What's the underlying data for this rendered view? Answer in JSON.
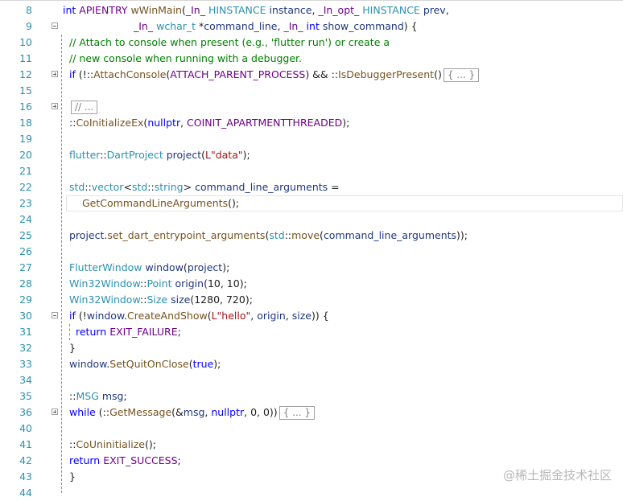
{
  "lines": [
    {
      "n": "8",
      "fold": "",
      "parts": [
        [
          "kw",
          "int "
        ],
        [
          "mac",
          "APIENTRY "
        ],
        [
          "fn",
          "wWinMain"
        ],
        [
          "pl",
          "("
        ],
        [
          "mac",
          "_In_ "
        ],
        [
          "ty",
          "HINSTANCE"
        ],
        [
          "id",
          " instance"
        ],
        [
          "pl",
          ", "
        ],
        [
          "mac",
          "_In_opt_ "
        ],
        [
          "ty",
          "HINSTANCE"
        ],
        [
          "id",
          " prev"
        ],
        [
          "pl",
          ","
        ]
      ]
    },
    {
      "n": "9",
      "fold": "minus",
      "parts": [
        [
          "mac",
          "_In_ "
        ],
        [
          "ty",
          "wchar_t"
        ],
        [
          "pl",
          " *"
        ],
        [
          "id",
          "command_line"
        ],
        [
          "pl",
          ", "
        ],
        [
          "mac",
          "_In_ "
        ],
        [
          "kw",
          "int "
        ],
        [
          "id",
          "show_command"
        ],
        [
          "pl",
          ") {"
        ]
      ]
    },
    {
      "n": "10",
      "fold": "",
      "parts": [
        [
          "cm",
          "// Attach to console when present (e.g., 'flutter run') or create a"
        ]
      ]
    },
    {
      "n": "11",
      "fold": "",
      "parts": [
        [
          "cm",
          "// new console when running with a debugger."
        ]
      ]
    },
    {
      "n": "12",
      "fold": "plus",
      "parts": [
        [
          "kw",
          "if "
        ],
        [
          "pl",
          "(!::"
        ],
        [
          "fn",
          "AttachConsole"
        ],
        [
          "pl",
          "("
        ],
        [
          "mac",
          "ATTACH_PARENT_PROCESS"
        ],
        [
          "pl",
          ") && ::"
        ],
        [
          "fn",
          "IsDebuggerPresent"
        ],
        [
          "pl",
          "()"
        ]
      ],
      "collapsed": "{ ... }"
    },
    {
      "n": "15",
      "fold": "",
      "parts": []
    },
    {
      "n": "16",
      "fold": "plus",
      "parts": [],
      "collapsed": "// ..."
    },
    {
      "n": "18",
      "fold": "",
      "parts": [
        [
          "pl",
          "::"
        ],
        [
          "fn",
          "CoInitializeEx"
        ],
        [
          "pl",
          "("
        ],
        [
          "kw",
          "nullptr"
        ],
        [
          "pl",
          ", "
        ],
        [
          "mac",
          "COINIT_APARTMENTTHREADED"
        ],
        [
          "pl",
          ");"
        ]
      ]
    },
    {
      "n": "19",
      "fold": "",
      "parts": []
    },
    {
      "n": "20",
      "fold": "",
      "parts": [
        [
          "ty",
          "flutter"
        ],
        [
          "pl",
          "::"
        ],
        [
          "ty",
          "DartProject"
        ],
        [
          "id",
          " project"
        ],
        [
          "pl",
          "("
        ],
        [
          "str",
          "L\"data\""
        ],
        [
          "pl",
          ");"
        ]
      ]
    },
    {
      "n": "21",
      "fold": "",
      "parts": []
    },
    {
      "n": "22",
      "fold": "",
      "parts": [
        [
          "ty",
          "std"
        ],
        [
          "pl",
          "::"
        ],
        [
          "ty",
          "vector"
        ],
        [
          "pl",
          "<"
        ],
        [
          "ty",
          "std"
        ],
        [
          "pl",
          "::"
        ],
        [
          "ty",
          "string"
        ],
        [
          "pl",
          "> "
        ],
        [
          "id",
          "command_line_arguments"
        ],
        [
          "pl",
          " ="
        ]
      ]
    },
    {
      "n": "23",
      "fold": "",
      "indent": 1,
      "parts": [
        [
          "fn",
          "GetCommandLineArguments"
        ],
        [
          "pl",
          "();"
        ]
      ]
    },
    {
      "n": "24",
      "fold": "",
      "parts": []
    },
    {
      "n": "25",
      "fold": "",
      "parts": [
        [
          "id",
          "project"
        ],
        [
          "pl",
          "."
        ],
        [
          "fn",
          "set_dart_entrypoint_arguments"
        ],
        [
          "pl",
          "("
        ],
        [
          "ty",
          "std"
        ],
        [
          "pl",
          "::"
        ],
        [
          "fn",
          "move"
        ],
        [
          "pl",
          "("
        ],
        [
          "id",
          "command_line_arguments"
        ],
        [
          "pl",
          "));"
        ]
      ]
    },
    {
      "n": "26",
      "fold": "",
      "parts": []
    },
    {
      "n": "27",
      "fold": "",
      "parts": [
        [
          "ty",
          "FlutterWindow"
        ],
        [
          "id",
          " window"
        ],
        [
          "pl",
          "("
        ],
        [
          "id",
          "project"
        ],
        [
          "pl",
          ");"
        ]
      ]
    },
    {
      "n": "28",
      "fold": "",
      "parts": [
        [
          "ty",
          "Win32Window"
        ],
        [
          "pl",
          "::"
        ],
        [
          "ty",
          "Point"
        ],
        [
          "id",
          " origin"
        ],
        [
          "pl",
          "(10, 10);"
        ]
      ]
    },
    {
      "n": "29",
      "fold": "",
      "parts": [
        [
          "ty",
          "Win32Window"
        ],
        [
          "pl",
          "::"
        ],
        [
          "ty",
          "Size"
        ],
        [
          "id",
          " size"
        ],
        [
          "pl",
          "(1280, 720);"
        ]
      ]
    },
    {
      "n": "30",
      "fold": "minus",
      "parts": [
        [
          "kw",
          "if "
        ],
        [
          "pl",
          "(!"
        ],
        [
          "id",
          "window"
        ],
        [
          "pl",
          "."
        ],
        [
          "fn",
          "CreateAndShow"
        ],
        [
          "pl",
          "("
        ],
        [
          "str",
          "L\"hello\""
        ],
        [
          "pl",
          ", "
        ],
        [
          "id",
          "origin"
        ],
        [
          "pl",
          ", "
        ],
        [
          "id",
          "size"
        ],
        [
          "pl",
          ")) {"
        ]
      ]
    },
    {
      "n": "31",
      "fold": "",
      "indent": 0.5,
      "parts": [
        [
          "kw",
          "return "
        ],
        [
          "mac",
          "EXIT_FAILURE"
        ],
        [
          "pl",
          ";"
        ]
      ]
    },
    {
      "n": "32",
      "fold": "",
      "parts": [
        [
          "pl",
          "}"
        ]
      ]
    },
    {
      "n": "33",
      "fold": "",
      "parts": [
        [
          "id",
          "window"
        ],
        [
          "pl",
          "."
        ],
        [
          "fn",
          "SetQuitOnClose"
        ],
        [
          "pl",
          "("
        ],
        [
          "kw",
          "true"
        ],
        [
          "pl",
          ");"
        ]
      ]
    },
    {
      "n": "34",
      "fold": "",
      "parts": []
    },
    {
      "n": "35",
      "fold": "",
      "parts": [
        [
          "pl",
          "::"
        ],
        [
          "ty",
          "MSG"
        ],
        [
          "id",
          " msg"
        ],
        [
          "pl",
          ";"
        ]
      ]
    },
    {
      "n": "36",
      "fold": "plus",
      "parts": [
        [
          "kw",
          "while "
        ],
        [
          "pl",
          "(::"
        ],
        [
          "fn",
          "GetMessage"
        ],
        [
          "pl",
          "(&"
        ],
        [
          "id",
          "msg"
        ],
        [
          "pl",
          ", "
        ],
        [
          "kw",
          "nullptr"
        ],
        [
          "pl",
          ", 0, 0))"
        ]
      ],
      "collapsed": "{ ... }"
    },
    {
      "n": "40",
      "fold": "",
      "parts": []
    },
    {
      "n": "41",
      "fold": "",
      "parts": [
        [
          "pl",
          "::"
        ],
        [
          "fn",
          "CoUninitialize"
        ],
        [
          "pl",
          "();"
        ]
      ]
    },
    {
      "n": "42",
      "fold": "",
      "parts": [
        [
          "kw",
          "return "
        ],
        [
          "mac",
          "EXIT_SUCCESS"
        ],
        [
          "pl",
          ";"
        ]
      ]
    },
    {
      "n": "43",
      "fold": "",
      "parts": [
        [
          "pl",
          "}"
        ]
      ]
    },
    {
      "n": "44",
      "fold": "",
      "parts": []
    }
  ],
  "watermark": "@稀土掘金技术社区",
  "colors": {
    "keyword": "#0000ff",
    "function": "#74531f",
    "type": "#2b91af",
    "macro": "#6f008a",
    "string": "#a31515",
    "comment": "#008000",
    "identifier": "#1f377f",
    "line_number": "#2b91af"
  }
}
